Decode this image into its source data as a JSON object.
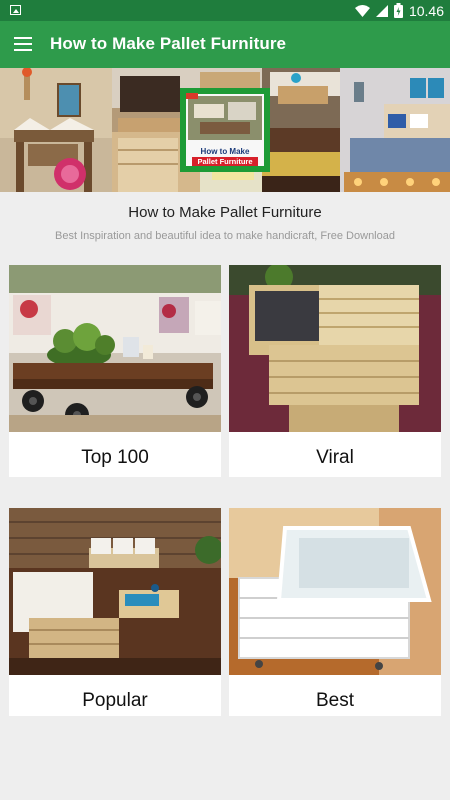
{
  "status_bar": {
    "time": "10.46",
    "icons": [
      "image-icon",
      "wifi-icon",
      "battery-charging-icon"
    ]
  },
  "app_bar": {
    "title": "How to Make Pallet Furniture",
    "menu_icon": "hamburger-menu-icon"
  },
  "banner": {
    "badge_line1": "How to Make",
    "badge_line2": "Pallet Furniture"
  },
  "header": {
    "title": "How to Make Pallet Furniture",
    "subtitle": "Best Inspiration and beautiful idea to make handicraft, Free Download"
  },
  "categories": [
    {
      "label": "Top 100"
    },
    {
      "label": "Viral"
    },
    {
      "label": "Popular"
    },
    {
      "label": "Best"
    }
  ],
  "colors": {
    "status_bar": "#1f7d3d",
    "app_bar": "#2e9b4b",
    "background": "#eeeeee"
  }
}
